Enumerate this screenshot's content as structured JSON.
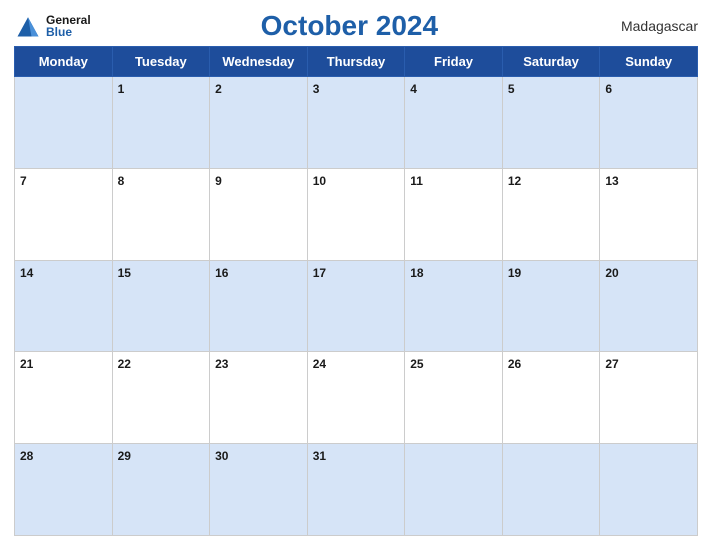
{
  "header": {
    "logo_general": "General",
    "logo_blue": "Blue",
    "title": "October 2024",
    "country": "Madagascar"
  },
  "days_of_week": [
    "Monday",
    "Tuesday",
    "Wednesday",
    "Thursday",
    "Friday",
    "Saturday",
    "Sunday"
  ],
  "weeks": [
    [
      "",
      "1",
      "2",
      "3",
      "4",
      "5",
      "6"
    ],
    [
      "7",
      "8",
      "9",
      "10",
      "11",
      "12",
      "13"
    ],
    [
      "14",
      "15",
      "16",
      "17",
      "18",
      "19",
      "20"
    ],
    [
      "21",
      "22",
      "23",
      "24",
      "25",
      "26",
      "27"
    ],
    [
      "28",
      "29",
      "30",
      "31",
      "",
      "",
      ""
    ]
  ]
}
